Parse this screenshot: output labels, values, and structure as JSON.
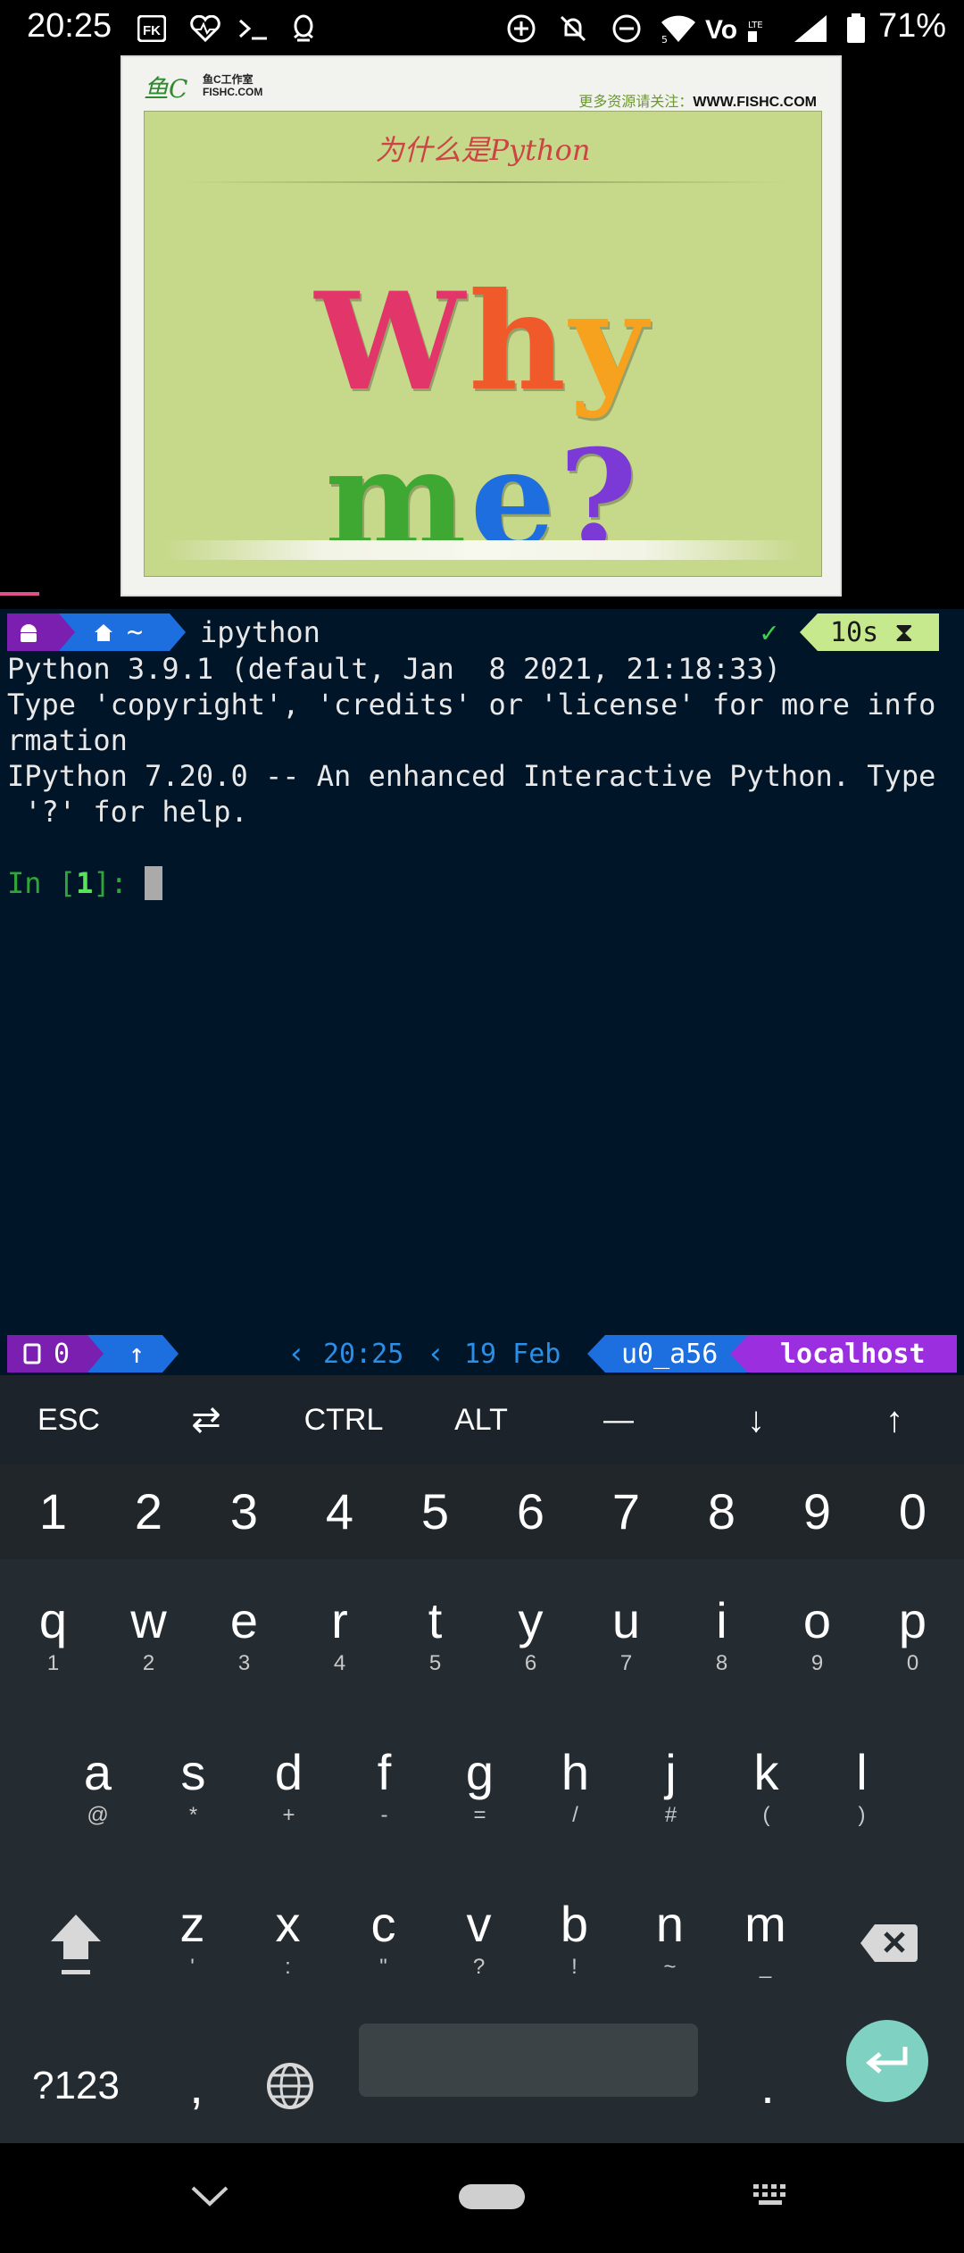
{
  "status_bar": {
    "time": "20:25",
    "battery_percent": "71%",
    "left_icons": [
      "fk-app-icon",
      "heart-monitor-icon",
      "terminal-icon",
      "qq-icon"
    ],
    "right_icons": [
      "add-circle-icon",
      "notifications-off-icon",
      "do-not-disturb-icon",
      "wifi-icon",
      "volte-icon",
      "signal-icon",
      "battery-icon"
    ]
  },
  "video": {
    "logo_text": "鱼C",
    "logo_sub1": "鱼C工作室",
    "logo_sub2": "FISHC.COM",
    "site_label": "更多资源请关注：",
    "site_url": "WWW.FISHC.COM",
    "slide_title": "为什么是Python",
    "big_text": "Why me?"
  },
  "terminal": {
    "top_bar": {
      "segment_android": "",
      "segment_home": "~",
      "command": "ipython",
      "status_check": "✓",
      "duration": "10s",
      "hourglass": "⧗"
    },
    "lines": [
      "Python 3.9.1 (default, Jan  8 2021, 21:18:33)",
      "Type 'copyright', 'credits' or 'license' for more info",
      "rmation",
      "IPython 7.20.0 -- An enhanced Interactive Python. Type",
      " '?' for help."
    ],
    "prompt": {
      "in_label": "In [",
      "number": "1",
      "close": "]: "
    },
    "bottom_bar": {
      "sessions": "0",
      "arrow": "↑",
      "clock": "20:25",
      "date": "19 Feb",
      "user": "u0_a56",
      "host": "localhost"
    }
  },
  "extra_keys": [
    "ESC",
    "⇄",
    "CTRL",
    "ALT",
    "—",
    "↓",
    "↑"
  ],
  "keyboard": {
    "numbers": [
      "1",
      "2",
      "3",
      "4",
      "5",
      "6",
      "7",
      "8",
      "9",
      "0"
    ],
    "row1": [
      {
        "k": "q",
        "s": "1"
      },
      {
        "k": "w",
        "s": "2"
      },
      {
        "k": "e",
        "s": "3"
      },
      {
        "k": "r",
        "s": "4"
      },
      {
        "k": "t",
        "s": "5"
      },
      {
        "k": "y",
        "s": "6"
      },
      {
        "k": "u",
        "s": "7"
      },
      {
        "k": "i",
        "s": "8"
      },
      {
        "k": "o",
        "s": "9"
      },
      {
        "k": "p",
        "s": "0"
      }
    ],
    "row2": [
      {
        "k": "a",
        "s": "@"
      },
      {
        "k": "s",
        "s": "*"
      },
      {
        "k": "d",
        "s": "+"
      },
      {
        "k": "f",
        "s": "-"
      },
      {
        "k": "g",
        "s": "="
      },
      {
        "k": "h",
        "s": "/"
      },
      {
        "k": "j",
        "s": "#"
      },
      {
        "k": "k",
        "s": "("
      },
      {
        "k": "l",
        "s": ")"
      }
    ],
    "row3": [
      {
        "k": "z",
        "s": "'"
      },
      {
        "k": "x",
        "s": ":"
      },
      {
        "k": "c",
        "s": "\""
      },
      {
        "k": "v",
        "s": "?"
      },
      {
        "k": "b",
        "s": "!"
      },
      {
        "k": "n",
        "s": "~"
      },
      {
        "k": "m",
        "s": "_"
      }
    ],
    "symbols_key": "?123",
    "comma_key": ",",
    "period_key": ".",
    "accent_color": "#7fd1c2"
  }
}
